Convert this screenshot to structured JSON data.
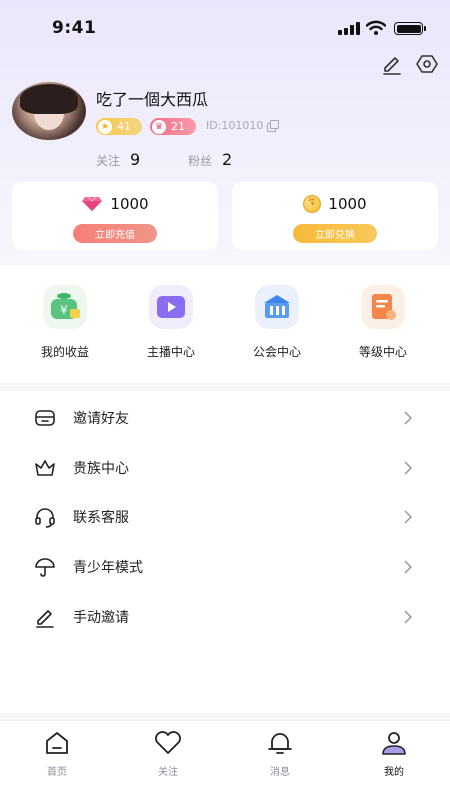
{
  "status_bar": {
    "time": "9:41"
  },
  "profile": {
    "username": "吃了一個大西瓜",
    "level_badge": "41",
    "vip_badge": "21",
    "user_id": "ID:101010",
    "follow_label": "关注",
    "follow_count": "9",
    "fans_label": "粉丝",
    "fans_count": "2"
  },
  "wallet": {
    "diamond_amount": "1000",
    "recharge_label": "立即充值",
    "coin_amount": "1000",
    "exchange_label": "立即兑换"
  },
  "quick_grid": [
    {
      "label": "我的收益",
      "icon": "money-bag-icon"
    },
    {
      "label": "主播中心",
      "icon": "video-play-icon"
    },
    {
      "label": "公会中心",
      "icon": "guild-building-icon"
    },
    {
      "label": "等级中心",
      "icon": "level-doc-icon"
    }
  ],
  "menu": [
    {
      "label": "邀请好友",
      "icon": "invite-box-icon"
    },
    {
      "label": "贵族中心",
      "icon": "crown-icon"
    },
    {
      "label": "联系客服",
      "icon": "headset-icon"
    },
    {
      "label": "青少年模式",
      "icon": "umbrella-icon"
    },
    {
      "label": "手动邀请",
      "icon": "pen-icon"
    }
  ],
  "tabs": [
    {
      "label": "首页",
      "icon": "home-icon",
      "active": false
    },
    {
      "label": "关注",
      "icon": "heart-icon",
      "active": false
    },
    {
      "label": "消息",
      "icon": "bell-icon",
      "active": false
    },
    {
      "label": "我的",
      "icon": "profile-icon",
      "active": true
    }
  ],
  "colors": {
    "header_gradient_top": "#ebe6fb",
    "recharge_button": "#f77f76",
    "exchange_button": "#f7b93b",
    "level_badge": "#f7c748",
    "vip_badge": "#f26e86"
  }
}
